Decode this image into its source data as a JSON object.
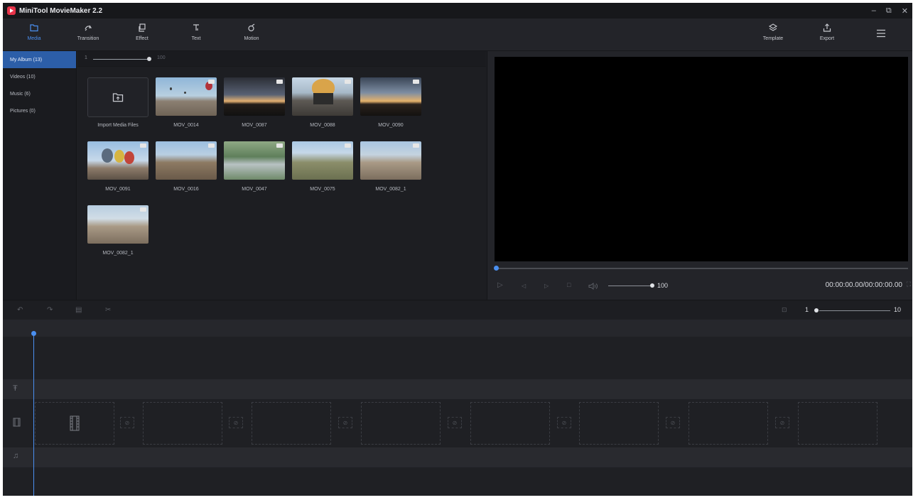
{
  "app": {
    "title": "MiniTool MovieMaker 2.2"
  },
  "window_controls": {
    "minimize": "–",
    "restore": "⧉",
    "close": "✕"
  },
  "toolbar": {
    "left": [
      {
        "label": "Media",
        "icon": "folder-icon"
      },
      {
        "label": "Transition",
        "icon": "transition-icon"
      },
      {
        "label": "Effect",
        "icon": "effect-icon"
      },
      {
        "label": "Text",
        "icon": "text-icon"
      },
      {
        "label": "Motion",
        "icon": "motion-icon"
      }
    ],
    "right": [
      {
        "label": "Template",
        "icon": "template-icon"
      },
      {
        "label": "Export",
        "icon": "export-icon"
      }
    ],
    "menu_icon": "hamburger-menu-icon"
  },
  "sidebar": {
    "items": [
      {
        "label": "My Album (13)"
      },
      {
        "label": "Videos (10)"
      },
      {
        "label": "Music (6)"
      },
      {
        "label": "Pictures (0)"
      }
    ]
  },
  "media": {
    "zoom": {
      "min": "1",
      "max": "100"
    },
    "import_label": "Import Media Files",
    "clips": [
      {
        "name": "MOV_0014"
      },
      {
        "name": "MOV_0087"
      },
      {
        "name": "MOV_0088"
      },
      {
        "name": "MOV_0090"
      },
      {
        "name": "MOV_0091"
      },
      {
        "name": "MOV_0016"
      },
      {
        "name": "MOV_0047"
      },
      {
        "name": "MOV_0075"
      },
      {
        "name": "MOV_0082_1"
      },
      {
        "name": "MOV_0082_1"
      }
    ]
  },
  "preview": {
    "volume": "100",
    "timecode": "00:00:00.00/00:00:00.00"
  },
  "timeline": {
    "zoom_min": "1",
    "zoom_max": "10"
  },
  "colors": {
    "accent": "#4a8ff0",
    "bg": "#1e1f23",
    "logo": "#e8344a"
  }
}
